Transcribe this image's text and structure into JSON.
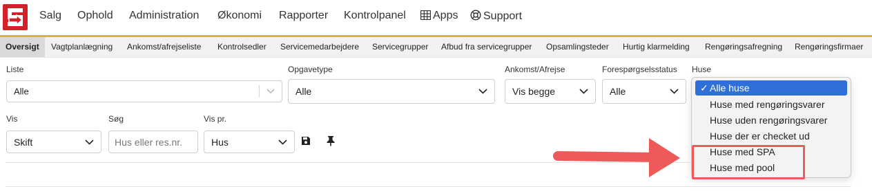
{
  "topnav": {
    "items": [
      "Salg",
      "Ophold",
      "Administration",
      "Økonomi",
      "Rapporter",
      "Kontrolpanel"
    ],
    "apps_label": "Apps",
    "support_label": "Support"
  },
  "subnav": {
    "items": [
      "Oversigt",
      "Vagtplanlægning",
      "Ankomst/afrejseliste",
      "Kontrolsedler",
      "Servicemedarbejdere",
      "Servicegrupper",
      "Afbud fra servicegrupper",
      "Opsamlingsteder",
      "Hurtig klarmelding",
      "Rengøringsafregning",
      "Rengøringsfirmaer"
    ],
    "active": "Oversigt"
  },
  "filters": {
    "liste": {
      "label": "Liste",
      "value": "Alle"
    },
    "opgavetype": {
      "label": "Opgavetype",
      "value": "Alle"
    },
    "ankomst": {
      "label": "Ankomst/Afrejse",
      "value": "Vis begge"
    },
    "status": {
      "label": "Forespørgselsstatus",
      "value": "Alle"
    },
    "huse": {
      "label": "Huse"
    },
    "vis": {
      "label": "Vis",
      "value": "Skift"
    },
    "sog": {
      "label": "Søg",
      "placeholder": "Hus eller res.nr."
    },
    "vispr": {
      "label": "Vis pr.",
      "value": "Hus"
    }
  },
  "huse_dropdown": {
    "options": [
      "Alle huse",
      "Huse med rengøringsvarer",
      "Huse uden rengøringsvarer",
      "Huse der er checket ud",
      "Huse med SPA",
      "Huse med pool"
    ],
    "selected": "Alle huse",
    "check_mark": "✓"
  },
  "colors": {
    "brand_red": "#d42027",
    "accent_orange": "#f2a72f",
    "selection_blue": "#2f6fd8",
    "annotation_red": "#ee5a5a"
  },
  "icons": [
    "logo-icon",
    "grid-icon",
    "lifebuoy-icon",
    "chevron-down-icon",
    "save-icon",
    "pin-icon",
    "arrow-annotation"
  ]
}
